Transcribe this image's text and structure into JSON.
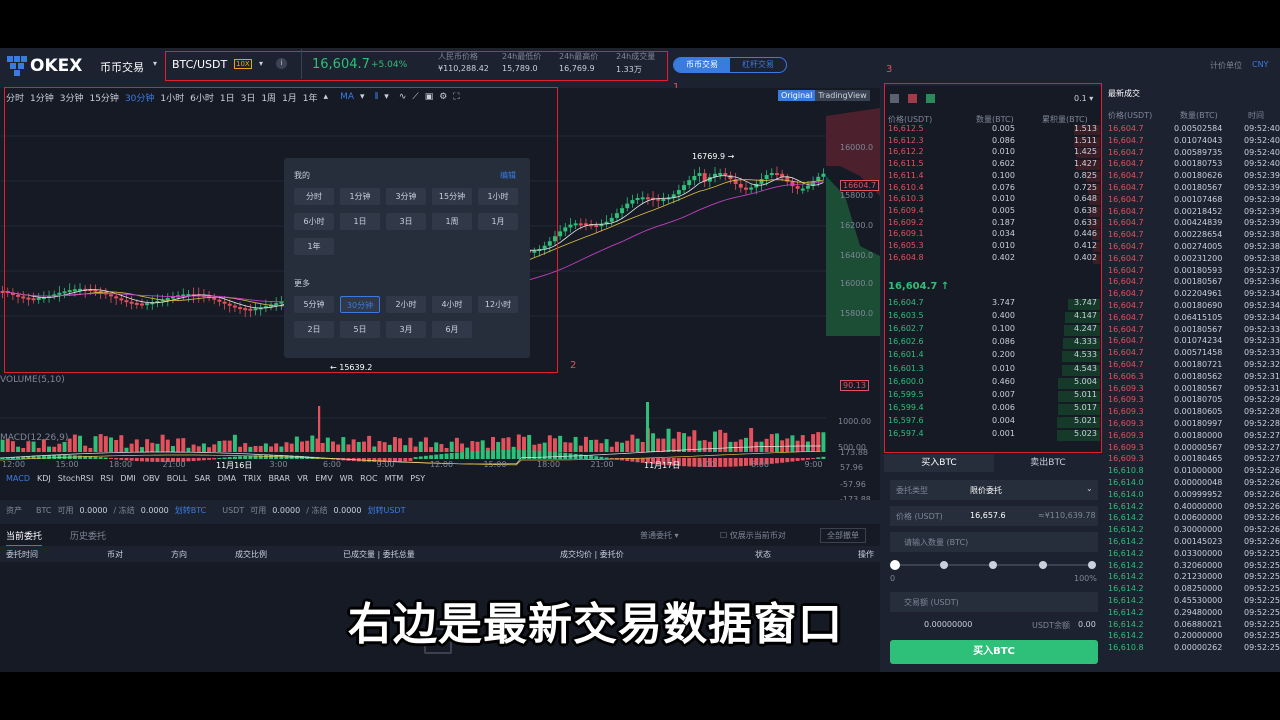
{
  "brand": {
    "name": "OKEX",
    "menu": "币币交易"
  },
  "ticker": {
    "pair": "BTC/USDT",
    "leverage": "10X",
    "price": "16,604.7",
    "change": "+5.04%",
    "stats": [
      {
        "label": "人民币价格",
        "value": "¥110,288.42"
      },
      {
        "label": "24h最低价",
        "value": "15,789.0"
      },
      {
        "label": "24h最高价",
        "value": "16,769.9"
      },
      {
        "label": "24h成交量",
        "value": "1.33万"
      }
    ]
  },
  "annotations": [
    "1",
    "2",
    "3"
  ],
  "mode_tabs": [
    "币币交易",
    "杠杆交易"
  ],
  "unit": {
    "label": "计价单位",
    "value": "CNY"
  },
  "toolbar": {
    "intervals": [
      "分时",
      "1分钟",
      "3分钟",
      "15分钟",
      "30分钟",
      "1小时",
      "6小时",
      "1日",
      "3日",
      "1周",
      "1月",
      "1年"
    ],
    "ma": "MA",
    "views": [
      "Original",
      "TradingView"
    ]
  },
  "popup": {
    "mine": "我的",
    "edit": "编辑",
    "my_items": [
      "分时",
      "1分钟",
      "3分钟",
      "15分钟",
      "1小时",
      "6小时",
      "1日",
      "3日",
      "1周",
      "1月",
      "1年"
    ],
    "more": "更多",
    "more_items": [
      "5分钟",
      "30分钟",
      "2小时",
      "4小时",
      "12小时",
      "2日",
      "5日",
      "3月",
      "6月"
    ]
  },
  "chart": {
    "high_label": "16769.9",
    "low_label": "15639.2",
    "price_tag": "16604.7",
    "price_axis": [
      "16000.0",
      "15800.0",
      "16200.0",
      "16400.0",
      "16000.0",
      "15800.0"
    ],
    "volume_label": "VOLUME(5,10)",
    "vol_axis": [
      "1000.00",
      "500.00"
    ],
    "vol_tag": "90.13",
    "macd_label": "MACD(12,26,9)",
    "macd_axis": [
      "173.88",
      "57.96",
      "-57.96",
      "-173.88"
    ],
    "time_axis": [
      "12:00",
      "15:00",
      "18:00",
      "21:00",
      "11月16日",
      "3:00",
      "6:00",
      "9:00",
      "12:00",
      "15:00",
      "18:00",
      "21:00",
      "11月17日",
      "3:00",
      "6:00",
      "9:00"
    ],
    "indicators": [
      "MACD",
      "KDJ",
      "StochRSI",
      "RSI",
      "DMI",
      "OBV",
      "BOLL",
      "SAR",
      "DMA",
      "TRIX",
      "BRAR",
      "VR",
      "EMV",
      "WR",
      "ROC",
      "MTM",
      "PSY"
    ]
  },
  "assets": {
    "label": "资产",
    "btc": "BTC",
    "available": "可用",
    "btc_avail": "0.0000",
    "frozen": "/ 冻结",
    "btc_frozen": "0.0000",
    "transfer_btc": "划转BTC",
    "usdt": "USDT",
    "usdt_avail": "0.0000",
    "usdt_frozen": "0.0000",
    "transfer_usdt": "划转USDT"
  },
  "orders": {
    "tabs": [
      "当前委托",
      "历史委托"
    ],
    "type": "普通委托",
    "only_current": "仅展示当前币对",
    "cancel_all": "全部撤单",
    "columns": [
      "委托时间",
      "币对",
      "方向",
      "成交比例",
      "已成交量 | 委托总量",
      "成交均价 | 委托价",
      "状态",
      "操作"
    ]
  },
  "orderbook": {
    "depth": "0.1",
    "headers": [
      "价格(USDT)",
      "数量(BTC)",
      "累积量(BTC)"
    ],
    "asks": [
      [
        "16,612.5",
        "0.005",
        "1.513"
      ],
      [
        "16,612.3",
        "0.086",
        "1.511"
      ],
      [
        "16,612.2",
        "0.010",
        "1.425"
      ],
      [
        "16,611.5",
        "0.602",
        "1.427"
      ],
      [
        "16,611.4",
        "0.100",
        "0.825"
      ],
      [
        "16,610.4",
        "0.076",
        "0.725"
      ],
      [
        "16,610.3",
        "0.010",
        "0.648"
      ],
      [
        "16,609.4",
        "0.005",
        "0.638"
      ],
      [
        "16,609.2",
        "0.187",
        "0.633"
      ],
      [
        "16,609.1",
        "0.034",
        "0.446"
      ],
      [
        "16,605.3",
        "0.010",
        "0.412"
      ],
      [
        "16,604.8",
        "0.402",
        "0.402"
      ]
    ],
    "last": "16,604.7 ↑",
    "bids": [
      [
        "16,604.7",
        "3.747",
        "3.747"
      ],
      [
        "16,603.5",
        "0.400",
        "4.147"
      ],
      [
        "16,602.7",
        "0.100",
        "4.247"
      ],
      [
        "16,602.6",
        "0.086",
        "4.333"
      ],
      [
        "16,601.4",
        "0.200",
        "4.533"
      ],
      [
        "16,601.3",
        "0.010",
        "4.543"
      ],
      [
        "16,600.0",
        "0.460",
        "5.004"
      ],
      [
        "16,599.5",
        "0.007",
        "5.011"
      ],
      [
        "16,599.4",
        "0.006",
        "5.017"
      ],
      [
        "16,597.6",
        "0.004",
        "5.021"
      ],
      [
        "16,597.4",
        "0.001",
        "5.023"
      ]
    ]
  },
  "trade_form": {
    "buy_tab": "买入BTC",
    "sell_tab": "卖出BTC",
    "type_label": "委托类型",
    "type_value": "限价委托",
    "price_label": "价格 (USDT)",
    "price_value": "16,657.6",
    "price_cny": "≈¥110,639.78",
    "amount_placeholder": "请输入数量 (BTC)",
    "slider_min": "0",
    "slider_max": "100%",
    "total_label": "交易额 (USDT)",
    "total_value": "0.00000000",
    "balance_label": "USDT余额",
    "balance_value": "0.00",
    "submit": "买入BTC"
  },
  "trades": {
    "title": "最新成交",
    "headers": [
      "价格(USDT)",
      "数量(BTC)",
      "时间"
    ],
    "rows": [
      [
        "16,604.7",
        "0.00502584",
        "09:52:40",
        "r"
      ],
      [
        "16,604.7",
        "0.01074043",
        "09:52:40",
        "r"
      ],
      [
        "16,604.7",
        "0.00589735",
        "09:52:40",
        "r"
      ],
      [
        "16,604.7",
        "0.00180753",
        "09:52:40",
        "r"
      ],
      [
        "16,604.7",
        "0.00180626",
        "09:52:39",
        "r"
      ],
      [
        "16,604.7",
        "0.00180567",
        "09:52:39",
        "r"
      ],
      [
        "16,604.7",
        "0.00107468",
        "09:52:39",
        "r"
      ],
      [
        "16,604.7",
        "0.00218452",
        "09:52:39",
        "r"
      ],
      [
        "16,604.7",
        "0.00424839",
        "09:52:39",
        "r"
      ],
      [
        "16,604.7",
        "0.00228654",
        "09:52:38",
        "r"
      ],
      [
        "16,604.7",
        "0.00274005",
        "09:52:38",
        "r"
      ],
      [
        "16,604.7",
        "0.00231200",
        "09:52:38",
        "r"
      ],
      [
        "16,604.7",
        "0.00180593",
        "09:52:37",
        "r"
      ],
      [
        "16,604.7",
        "0.00180567",
        "09:52:36",
        "r"
      ],
      [
        "16,604.7",
        "0.02204961",
        "09:52:34",
        "r"
      ],
      [
        "16,604.7",
        "0.00180690",
        "09:52:34",
        "r"
      ],
      [
        "16,604.7",
        "0.06415105",
        "09:52:34",
        "r"
      ],
      [
        "16,604.7",
        "0.00180567",
        "09:52:33",
        "r"
      ],
      [
        "16,604.7",
        "0.01074234",
        "09:52:33",
        "r"
      ],
      [
        "16,604.7",
        "0.00571458",
        "09:52:33",
        "r"
      ],
      [
        "16,604.7",
        "0.00180721",
        "09:52:32",
        "r"
      ],
      [
        "16,606.3",
        "0.00180562",
        "09:52:31",
        "r"
      ],
      [
        "16,609.3",
        "0.00180567",
        "09:52:31",
        "r"
      ],
      [
        "16,609.3",
        "0.00180705",
        "09:52:29",
        "r"
      ],
      [
        "16,609.3",
        "0.00180605",
        "09:52:28",
        "r"
      ],
      [
        "16,609.3",
        "0.00180997",
        "09:52:28",
        "r"
      ],
      [
        "16,609.3",
        "0.00180000",
        "09:52:27",
        "r"
      ],
      [
        "16,609.3",
        "0.00000567",
        "09:52:27",
        "r"
      ],
      [
        "16,609.3",
        "0.00180465",
        "09:52:27",
        "r"
      ],
      [
        "16,610.8",
        "0.01000000",
        "09:52:26",
        "g"
      ],
      [
        "16,614.0",
        "0.00000048",
        "09:52:26",
        "g"
      ],
      [
        "16,614.0",
        "0.00999952",
        "09:52:26",
        "g"
      ],
      [
        "16,614.2",
        "0.40000000",
        "09:52:26",
        "g"
      ],
      [
        "16,614.2",
        "0.00600000",
        "09:52:26",
        "g"
      ],
      [
        "16,614.2",
        "0.30000000",
        "09:52:26",
        "g"
      ],
      [
        "16,614.2",
        "0.00145023",
        "09:52:26",
        "g"
      ],
      [
        "16,614.2",
        "0.03300000",
        "09:52:25",
        "g"
      ],
      [
        "16,614.2",
        "0.32060000",
        "09:52:25",
        "g"
      ],
      [
        "16,614.2",
        "0.21230000",
        "09:52:25",
        "g"
      ],
      [
        "16,614.2",
        "0.08250000",
        "09:52:25",
        "g"
      ],
      [
        "16,614.2",
        "0.45530000",
        "09:52:25",
        "g"
      ],
      [
        "16,614.2",
        "0.29480000",
        "09:52:25",
        "g"
      ],
      [
        "16,614.2",
        "0.06880021",
        "09:52:25",
        "g"
      ],
      [
        "16,614.2",
        "0.20000000",
        "09:52:25",
        "g"
      ],
      [
        "16,610.8",
        "0.00000262",
        "09:52:25",
        "g"
      ]
    ]
  },
  "subtitle": "右边是最新交易数据窗口"
}
